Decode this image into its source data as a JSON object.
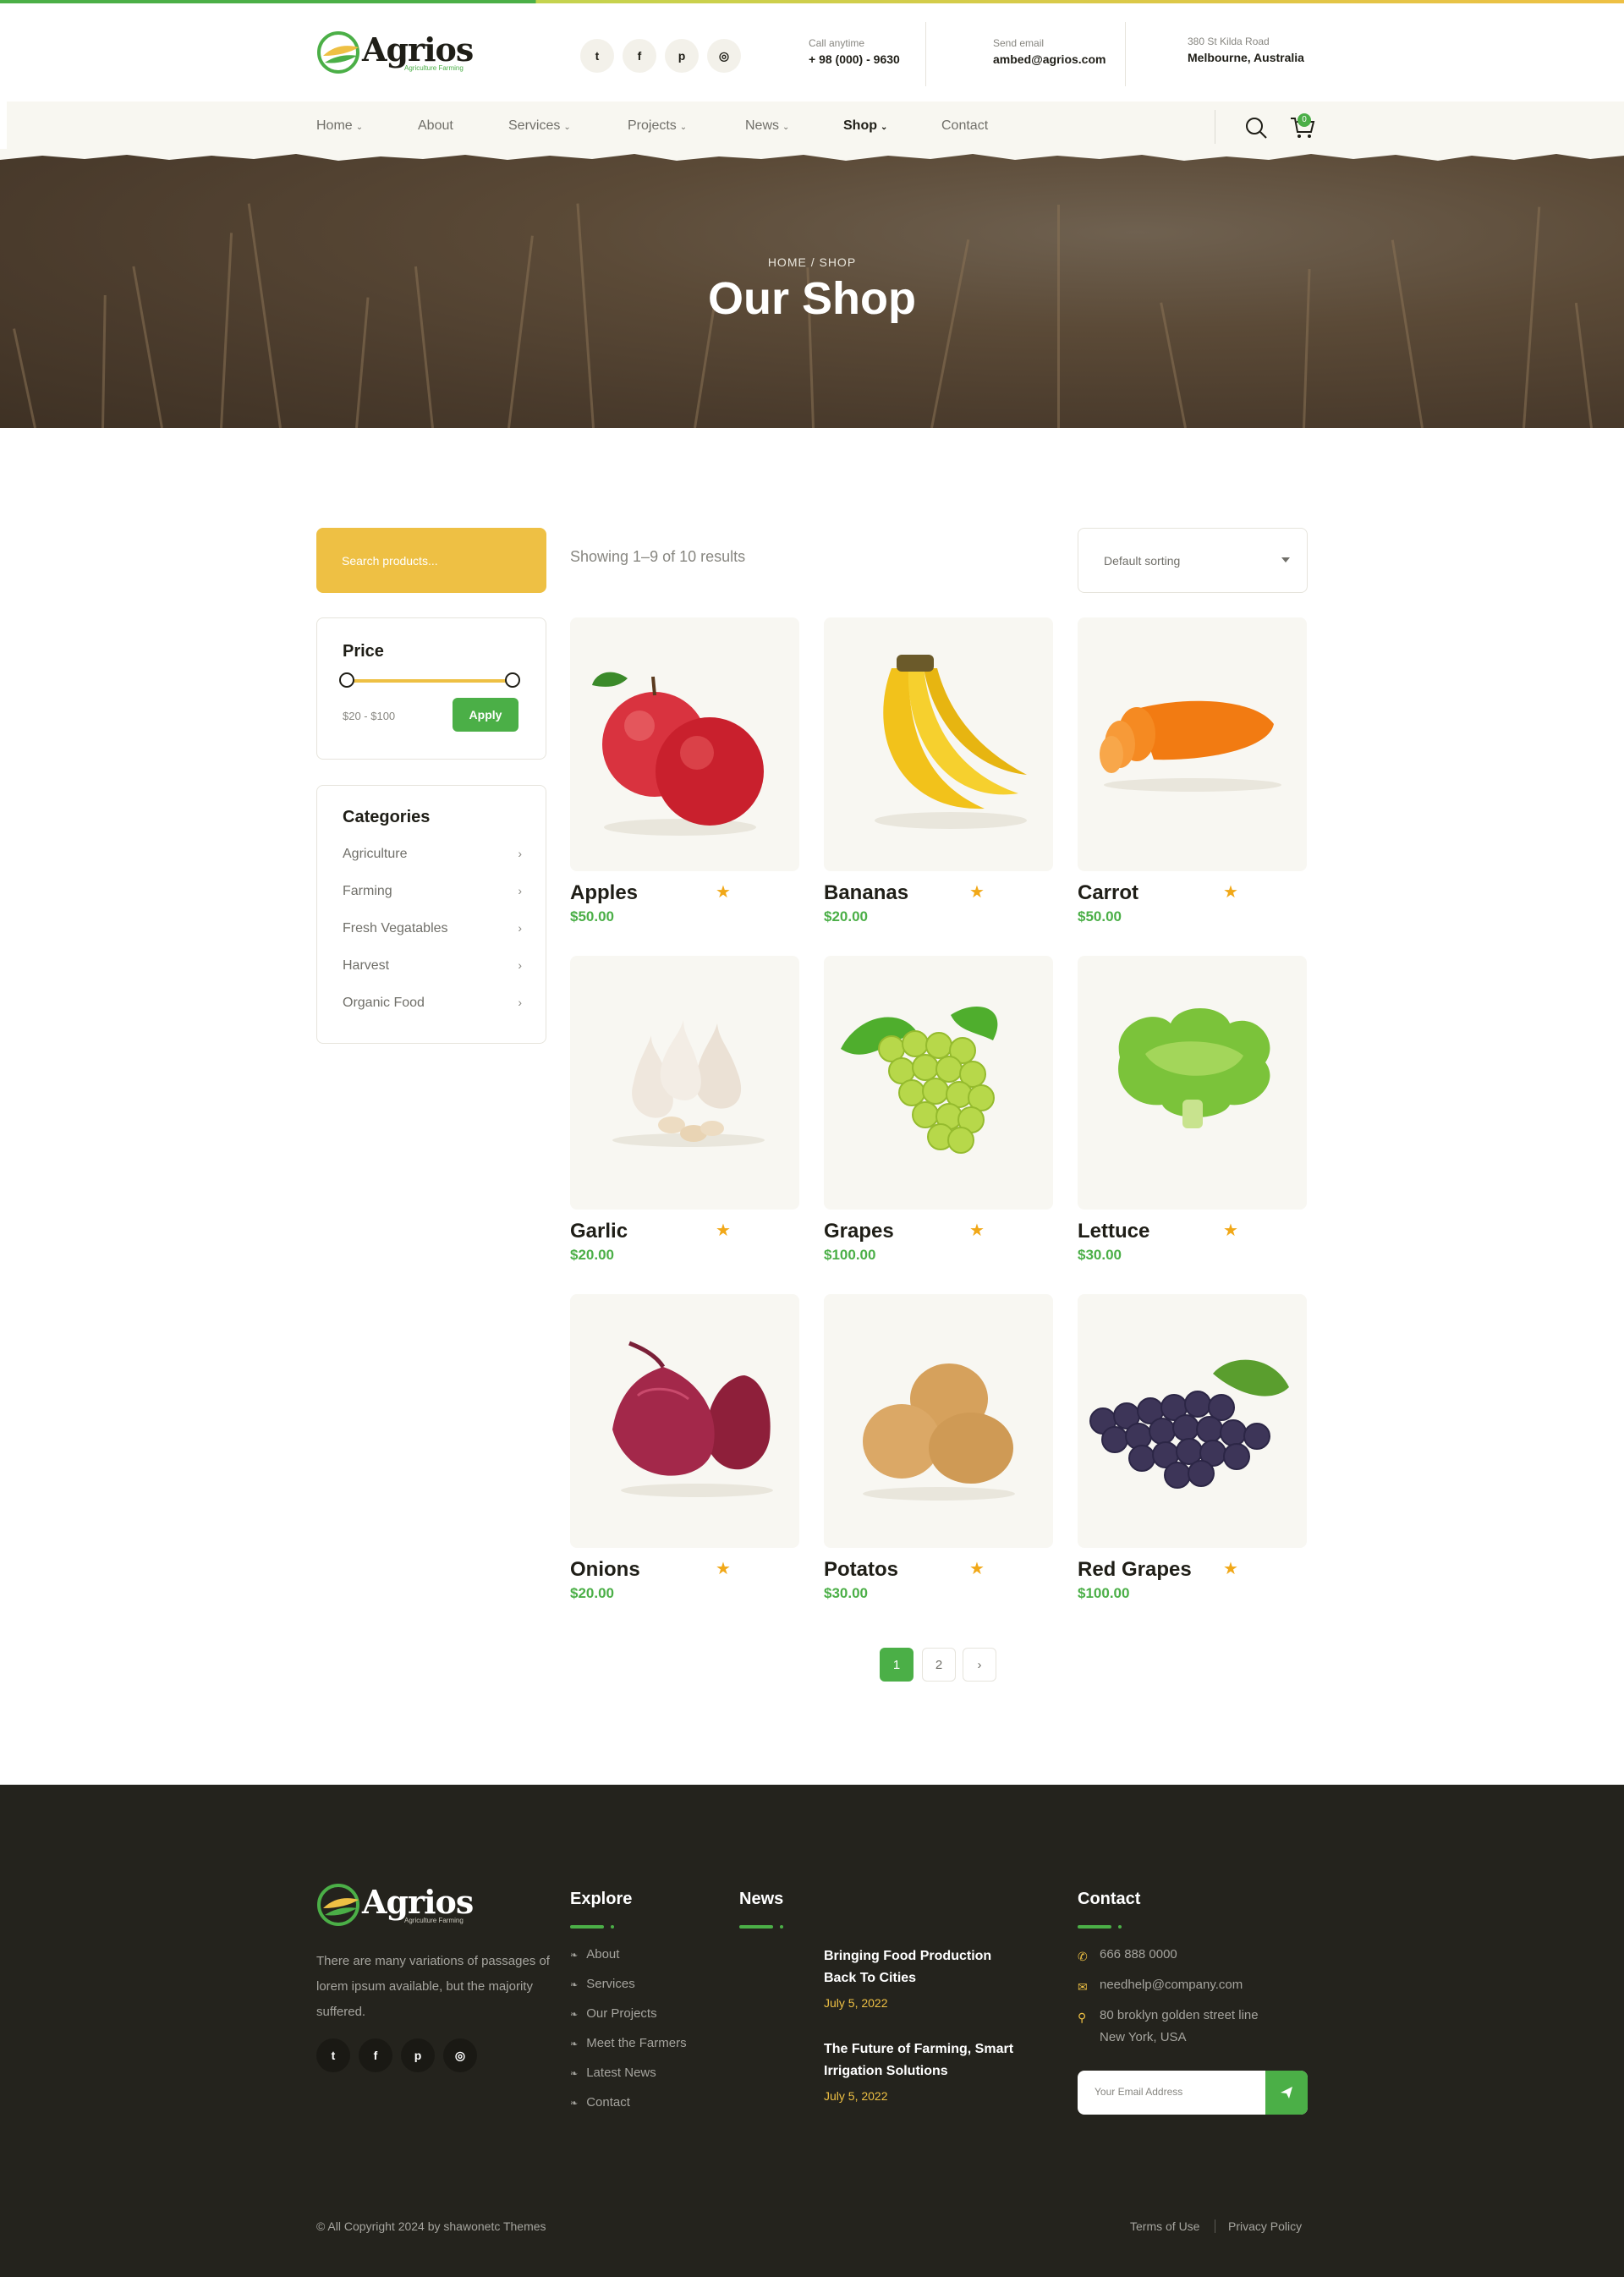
{
  "brand": {
    "name": "Agrios",
    "tagline": "Agriculture Farming",
    "colors": {
      "green": "#4baf47",
      "yellow": "#eec044",
      "dark": "#24231d",
      "star": "#f1a818"
    }
  },
  "header": {
    "socials": [
      {
        "icon": "twitter-icon",
        "glyph": "t"
      },
      {
        "icon": "facebook-icon",
        "glyph": "f"
      },
      {
        "icon": "pinterest-icon",
        "glyph": "p"
      },
      {
        "icon": "instagram-icon",
        "glyph": "◎"
      }
    ],
    "call_label": "Call anytime",
    "call_value": "+ 98 (000) - 9630",
    "email_label": "Send email",
    "email_value": "ambed@agrios.com",
    "address_label": "380 St Kilda Road",
    "address_value": "Melbourne, Australia"
  },
  "nav": {
    "items": [
      {
        "label": "Home",
        "has_dropdown": true
      },
      {
        "label": "About",
        "has_dropdown": false
      },
      {
        "label": "Services",
        "has_dropdown": true
      },
      {
        "label": "Projects",
        "has_dropdown": true
      },
      {
        "label": "News",
        "has_dropdown": true
      },
      {
        "label": "Shop",
        "has_dropdown": true,
        "active": true
      },
      {
        "label": "Contact",
        "has_dropdown": false
      }
    ],
    "cart_count": "0"
  },
  "hero": {
    "breadcrumb": "HOME  /  SHOP",
    "title": "Our Shop"
  },
  "sidebar": {
    "search_placeholder": "Search products...",
    "price_title": "Price",
    "price_range": "$20 - $100",
    "apply_label": "Apply",
    "categories_title": "Categories",
    "categories": [
      "Agriculture",
      "Farming",
      "Fresh Vegatables",
      "Harvest",
      "Organic Food"
    ]
  },
  "toolbar": {
    "showing": "Showing 1–9 of 10 results",
    "sort_selected": "Default sorting"
  },
  "products": [
    {
      "name": "Apples",
      "price": "$50.00",
      "rating": 1
    },
    {
      "name": "Bananas",
      "price": "$20.00",
      "rating": 1
    },
    {
      "name": "Carrot",
      "price": "$50.00",
      "rating": 1
    },
    {
      "name": "Garlic",
      "price": "$20.00",
      "rating": 1
    },
    {
      "name": "Grapes",
      "price": "$100.00",
      "rating": 1
    },
    {
      "name": "Lettuce",
      "price": "$30.00",
      "rating": 1
    },
    {
      "name": "Onions",
      "price": "$20.00",
      "rating": 1
    },
    {
      "name": "Potatos",
      "price": "$30.00",
      "rating": 1
    },
    {
      "name": "Red Grapes",
      "price": "$100.00",
      "rating": 1
    }
  ],
  "pagination": {
    "pages": [
      "1",
      "2"
    ],
    "current": "1",
    "next_icon": "chevron-right-icon"
  },
  "footer": {
    "about": "There are many variations of passages of lorem ipsum available, but the majority suffered.",
    "explore_title": "Explore",
    "explore_links": [
      "About",
      "Services",
      "Our Projects",
      "Meet the Farmers",
      "Latest News",
      "Contact"
    ],
    "news_title": "News",
    "news": [
      {
        "title": "Bringing Food Production Back To Cities",
        "date": "July 5, 2022"
      },
      {
        "title": "The Future of Farming, Smart Irrigation Solutions",
        "date": "July 5, 2022"
      }
    ],
    "contact_title": "Contact",
    "phone": "666 888 0000",
    "email": "needhelp@company.com",
    "address_line1": "80 broklyn golden street line",
    "address_line2": "New York, USA",
    "newsletter_placeholder": "Your Email Address",
    "copyright": "© All Copyright 2024 by shawonetc Themes",
    "terms": "Terms of Use",
    "privacy": "Privacy Policy"
  }
}
